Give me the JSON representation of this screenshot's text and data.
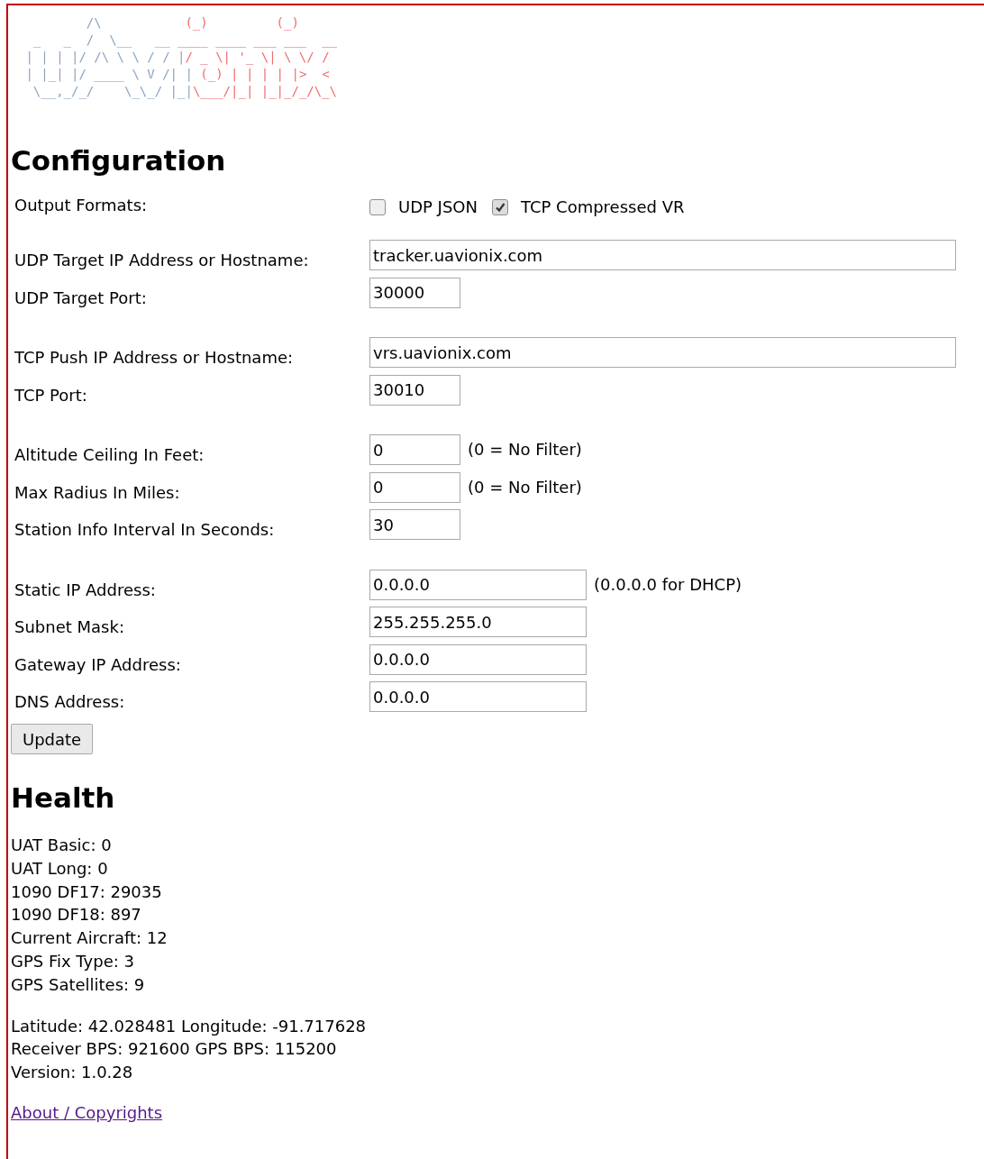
{
  "logo": {
    "lines": [
      {
        "left": "         /\\       ",
        "right": "    (_)         (_)"
      },
      {
        "left": "  _   _  /  \\__   __ _",
        "right": "___ ____ ___ ___  __"
      },
      {
        "left": " | | | |/ /\\ \\ \\ / / |",
        "right": "/ _ \\| '_ \\| \\ \\/ /"
      },
      {
        "left": " | |_| |/ ____ \\ V /| |",
        "right": " (_) | | | | |>  <"
      },
      {
        "left": "  \\__,_/_/    \\_\\_/ |_|",
        "right": "\\___/|_| |_|_/_/\\_\\"
      }
    ]
  },
  "configuration": {
    "title": "Configuration",
    "output_formats": {
      "label": "Output Formats:",
      "options": [
        {
          "label": "UDP JSON",
          "checked": false
        },
        {
          "label": "TCP Compressed VR",
          "checked": true
        }
      ]
    },
    "groups": [
      [
        {
          "label": "UDP Target IP Address or Hostname:",
          "value": "tracker.uavionix.com",
          "kind": "wide"
        },
        {
          "label": "UDP Target Port:",
          "value": "30000",
          "kind": "short"
        }
      ],
      [
        {
          "label": "TCP Push IP Address or Hostname:",
          "value": "vrs.uavionix.com",
          "kind": "wide"
        },
        {
          "label": "TCP Port:",
          "value": "30010",
          "kind": "short"
        }
      ],
      [
        {
          "label": "Altitude Ceiling In Feet:",
          "value": "0",
          "kind": "short",
          "note": "(0 = No Filter)"
        },
        {
          "label": "Max Radius In Miles:",
          "value": "0",
          "kind": "short",
          "note": "(0 = No Filter)"
        },
        {
          "label": "Station Info Interval In Seconds:",
          "value": "30",
          "kind": "short"
        }
      ],
      [
        {
          "label": "Static IP Address:",
          "value": "0.0.0.0",
          "kind": "medium",
          "note": "(0.0.0.0 for DHCP)"
        },
        {
          "label": "Subnet Mask:",
          "value": "255.255.255.0",
          "kind": "medium"
        },
        {
          "label": "Gateway IP Address:",
          "value": "0.0.0.0",
          "kind": "medium"
        },
        {
          "label": "DNS Address:",
          "value": "0.0.0.0",
          "kind": "medium"
        }
      ]
    ],
    "update_button": "Update"
  },
  "health": {
    "title": "Health",
    "counters": [
      "UAT Basic: 0",
      "UAT Long: 0",
      "1090 DF17: 29035",
      "1090 DF18: 897",
      "Current Aircraft: 12",
      "GPS Fix Type: 3",
      "GPS Satellites: 9"
    ],
    "details": [
      "Latitude: 42.028481 Longitude: -91.717628",
      "Receiver BPS: 921600 GPS BPS: 115200",
      "Version: 1.0.28"
    ]
  },
  "footer_link": "About / Copyrights"
}
